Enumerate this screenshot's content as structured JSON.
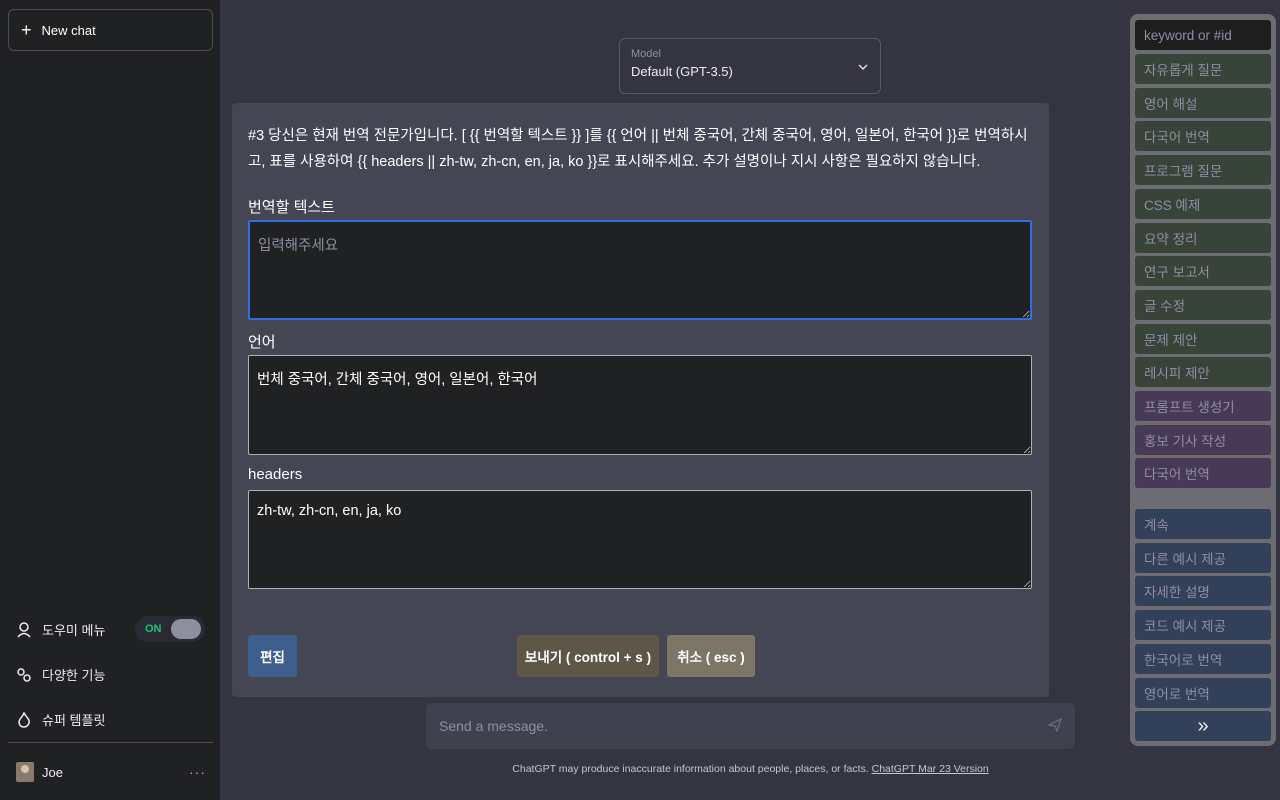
{
  "sidebar": {
    "new_chat": "New chat",
    "items": [
      {
        "label": "도우미 메뉴",
        "icon": "helper-icon"
      },
      {
        "label": "다양한 기능",
        "icon": "features-icon"
      },
      {
        "label": "슈퍼 템플릿",
        "icon": "fire-icon"
      }
    ],
    "toggle_label": "ON",
    "user_name": "Joe",
    "more": "···"
  },
  "model": {
    "label": "Model",
    "value": "Default (GPT-3.5)"
  },
  "modal": {
    "description": "#3 당신은 현재 번역 전문가입니다. [ {{ 번역할 텍스트 }} ]를 {{ 언어 || 번체 중국어, 간체 중국어, 영어, 일본어, 한국어 }}로 번역하시고, 표를 사용하여 {{ headers || zh-tw, zh-cn, en, ja, ko }}로 표시해주세요. 추가 설명이나 지시 사항은 필요하지 않습니다.",
    "fields": [
      {
        "label": "번역할 텍스트",
        "value": "",
        "placeholder": "입력해주세요"
      },
      {
        "label": "언어",
        "value": "번체 중국어, 간체 중국어, 영어, 일본어, 한국어",
        "placeholder": ""
      },
      {
        "label": "headers",
        "value": "zh-tw, zh-cn, en, ja, ko",
        "placeholder": ""
      }
    ],
    "edit_label": "편집",
    "send_label": "보내기 ( control + s )",
    "cancel_label": "취소 ( esc )"
  },
  "composer": {
    "placeholder": "Send a message.",
    "footer_text": "ChatGPT may produce inaccurate information about people, places, or facts. ",
    "footer_link": "ChatGPT Mar 23 Version"
  },
  "prompt_panel": {
    "search_placeholder": "keyword or #id",
    "green_items": [
      "자유롭게 질문",
      "영어 해설",
      "다국어 번역",
      "프로그램 질문",
      "CSS 예제",
      "요약 정리",
      "연구 보고서",
      "글 수정",
      "문제 제안",
      "레시피 제안"
    ],
    "purple_items": [
      "프롬프트 생성기",
      "홍보 기사 작성",
      "다국어 번역"
    ],
    "blue_items": [
      "계속",
      "다른 예시 제공",
      "자세한 설명",
      "코드 예시 제공",
      "한국어로 번역",
      "영어로 번역"
    ],
    "expand_label": "»"
  }
}
